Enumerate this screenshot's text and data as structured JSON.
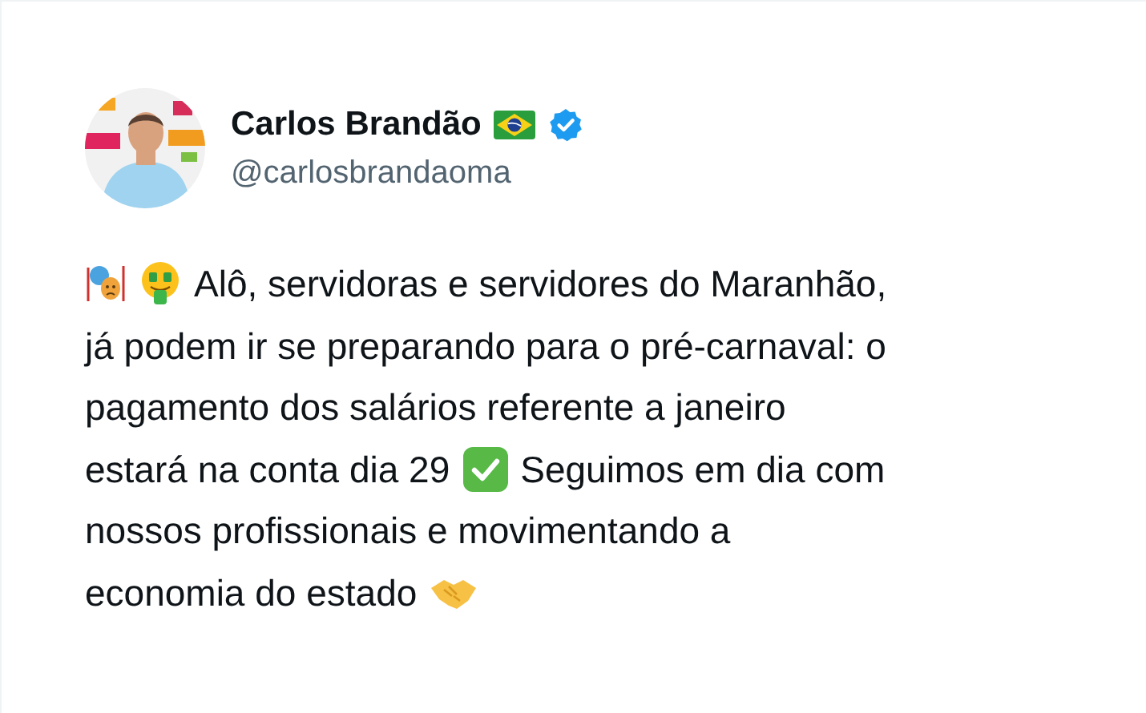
{
  "author": {
    "name": "Carlos Brandão",
    "handle": "@carlosbrandaoma",
    "verified": true
  },
  "tweet": {
    "lines": [
      [
        "Alô, servidoras e servidores do Maranhão,"
      ],
      [
        "já podem ir se preparando para o pré-carnaval: o"
      ],
      [
        "pagamento dos salários referente a janeiro"
      ],
      [
        "estará na conta dia 29",
        "Seguimos em dia com"
      ],
      [
        "nossos profissionais e movimentando a"
      ],
      [
        "economia do estado"
      ]
    ]
  }
}
